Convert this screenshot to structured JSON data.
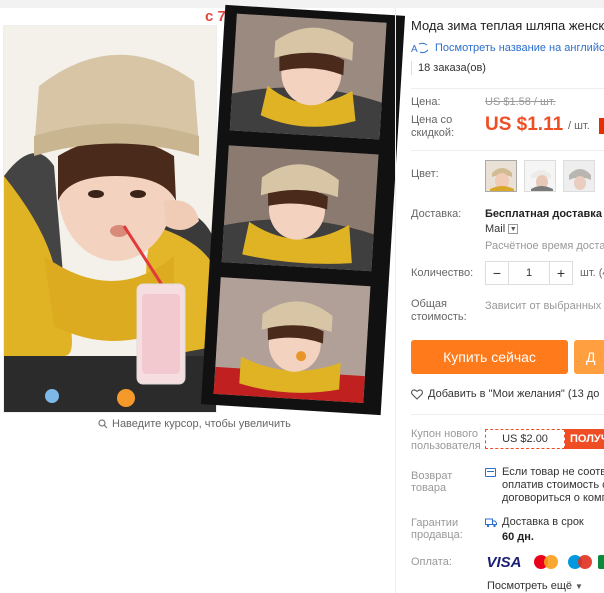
{
  "product": {
    "title": "Мода зима теплая шляпа женск",
    "translate_link": "Посмотреть название на английс",
    "orders": "18 заказа(ов)"
  },
  "gallery": {
    "zoom_hint": "Наведите курсор, чтобы увеличить",
    "mark": "с 7"
  },
  "price": {
    "label": "Цена:",
    "old": "US $1.58 / шт.",
    "discount_label": "Цена со скидкой:",
    "new": "US $1.11",
    "unit": "/ шт."
  },
  "color": {
    "label": "Цвет:"
  },
  "delivery": {
    "label": "Доставка:",
    "main": "Бесплатная доставка в",
    "method": "Mail",
    "time": "Расчётное время доставк"
  },
  "quantity": {
    "label": "Количество:",
    "value": "1",
    "minus": "−",
    "plus": "+",
    "unit": "шт. (4"
  },
  "total": {
    "label": "Общая стоимость:",
    "note": "Зависит от выбранных з"
  },
  "actions": {
    "buy": "Купить сейчас",
    "cart": "Д",
    "wishlist": "Добавить в \"Мои желания\" (13 до"
  },
  "coupon": {
    "label": "Купон нового пользователя",
    "value": "US $2.00",
    "get": "ПОЛУЧИ"
  },
  "returns": {
    "label": "Возврат товара",
    "line1": "Если товар не соотве",
    "line2": "оплатив стоимость с",
    "line3": "договориться о комп"
  },
  "guarantee": {
    "label": "Гарантии продавца:",
    "text": "Доставка в срок",
    "days": "60 дн."
  },
  "payment": {
    "label": "Оплата:",
    "visa": "VISA",
    "more": "Посмотреть ещё"
  },
  "colors": {
    "accent": "#ef4e25",
    "buy": "#ff7a1a",
    "link": "#2d6fcc"
  }
}
